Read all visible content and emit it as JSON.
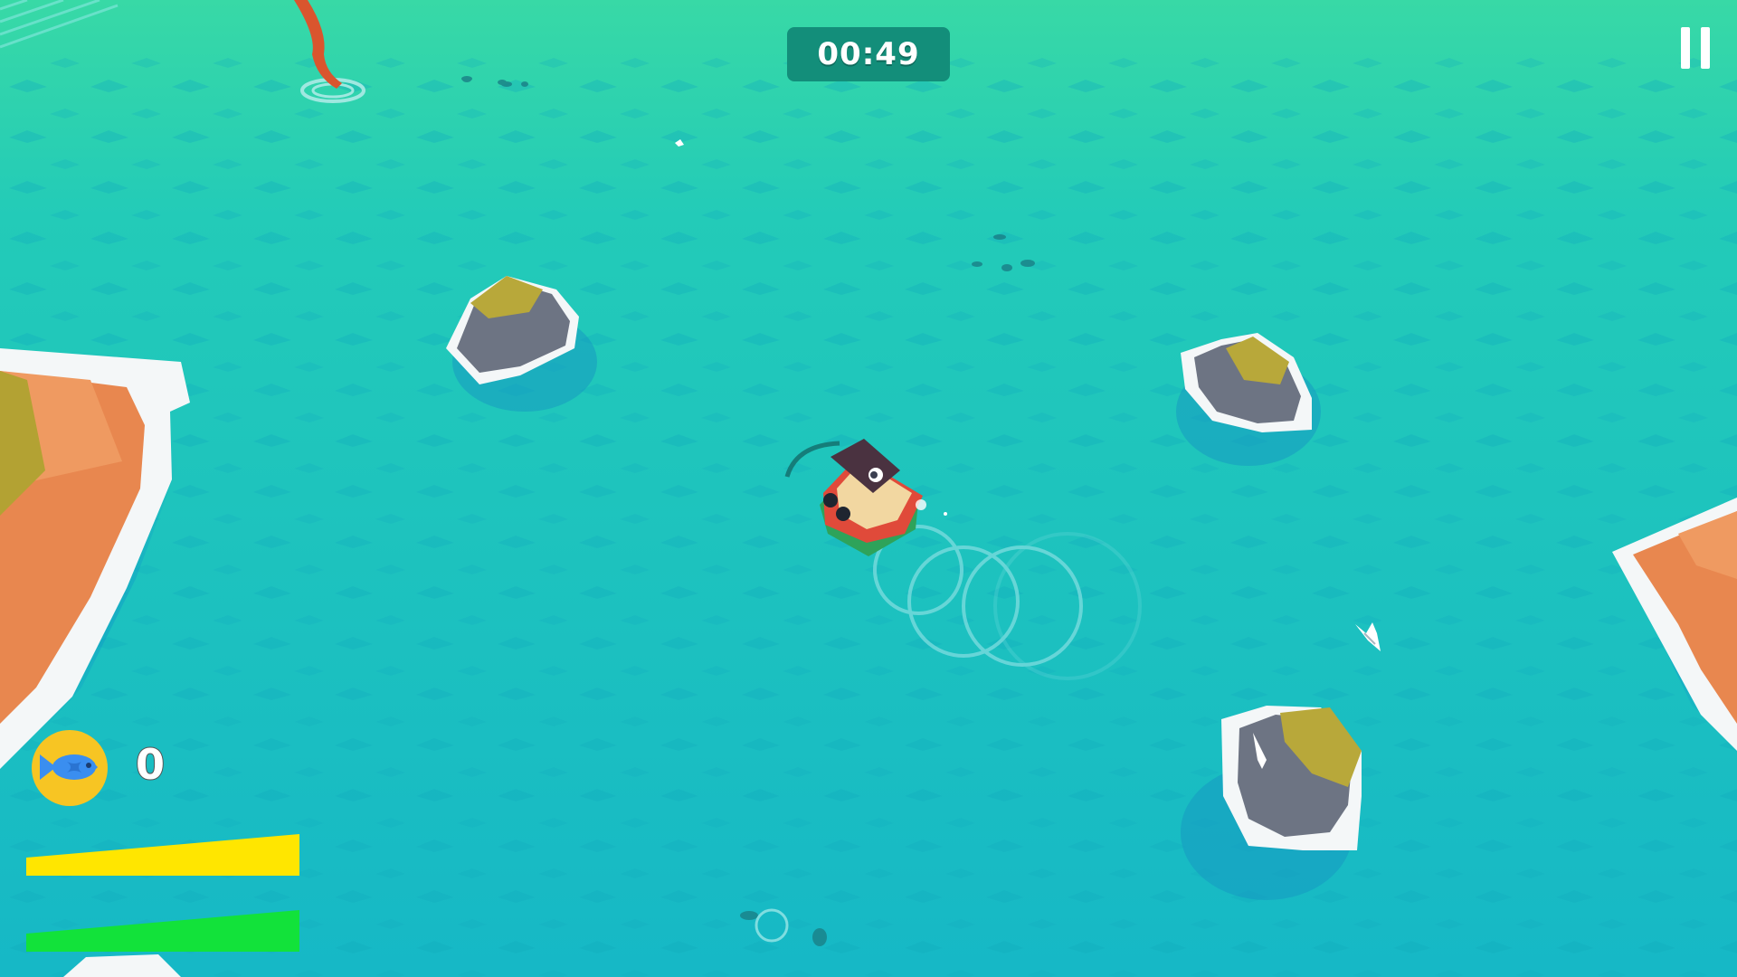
{
  "hud": {
    "timer": "00:49",
    "fish_count": "0",
    "fish_icon": "fish-icon",
    "pause_icon": "pause-icon"
  },
  "meters": {
    "yellow": {
      "level": 1.0,
      "color": "#ffe600"
    },
    "green": {
      "level": 1.0,
      "color": "#12e23a"
    }
  },
  "colors": {
    "water": "#1fc0c0",
    "water_top": "#3ad8a8",
    "island_orange": "#e8874f",
    "rock_gray": "#6d7483",
    "rock_top_olive": "#b8a83a",
    "timer_bg": "#138e7a",
    "badge_yellow": "#f7c523",
    "fish_blue": "#3a8ef0"
  }
}
